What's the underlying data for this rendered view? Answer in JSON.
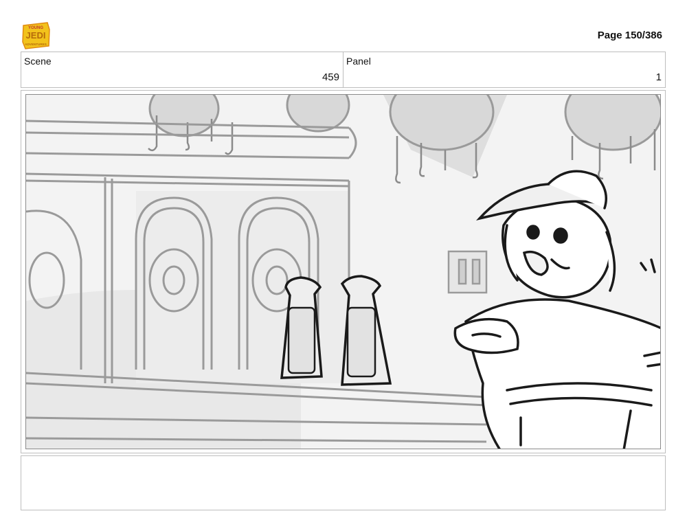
{
  "header": {
    "logo_text": [
      "YOUNG",
      "JEDI",
      "ADVENTURES"
    ],
    "page_label": "Page 150/386"
  },
  "info": {
    "scene_label": "Scene",
    "scene_value": "459",
    "panel_label": "Panel",
    "panel_value": "1"
  },
  "notes": {
    "text": ""
  },
  "colors": {
    "logo_yellow": "#f2c21b",
    "logo_orange": "#e08a12",
    "frame_border": "#bdbdbd",
    "sketch_ink": "#1a1a1a",
    "sketch_grey": "#9a9a9a"
  }
}
